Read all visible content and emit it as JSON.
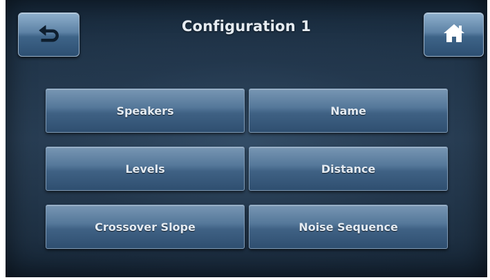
{
  "header": {
    "title": "Configuration 1",
    "back_icon": "back-arrow-icon",
    "home_icon": "home-icon"
  },
  "menu": {
    "items": [
      {
        "label": "Speakers"
      },
      {
        "label": "Name"
      },
      {
        "label": "Levels"
      },
      {
        "label": "Distance"
      },
      {
        "label": "Crossover Slope"
      },
      {
        "label": "Noise Sequence"
      }
    ]
  },
  "colors": {
    "background": "#1f3347",
    "button": "#4a6d90",
    "text": "#e4ebf2"
  }
}
